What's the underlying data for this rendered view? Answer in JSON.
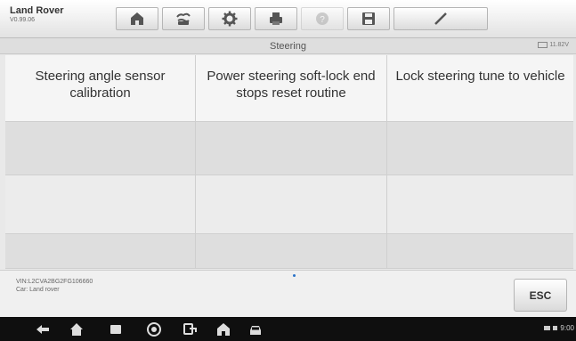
{
  "header": {
    "brand": "Land Rover",
    "version": "V0.99.06"
  },
  "toolbar": [
    {
      "name": "home-icon"
    },
    {
      "name": "vehicle-swap-icon"
    },
    {
      "name": "settings-icon"
    },
    {
      "name": "print-icon"
    },
    {
      "name": "help-icon"
    },
    {
      "name": "save-icon"
    },
    {
      "name": "edit-icon"
    }
  ],
  "subheader": {
    "title": "Steering",
    "battery": "11.82V"
  },
  "functions": [
    "Steering angle sensor calibration",
    "Power steering soft-lock end stops reset routine",
    "Lock steering tune to vehicle"
  ],
  "footer": {
    "vin": "VIN:L2CVA2BG2FG106660",
    "car": "Car: Land rover",
    "esc_label": "ESC"
  },
  "navbar": {
    "clock": "9:00"
  },
  "colors": {
    "accent": "#2a72c9",
    "navbar": "#0f0f0f"
  }
}
